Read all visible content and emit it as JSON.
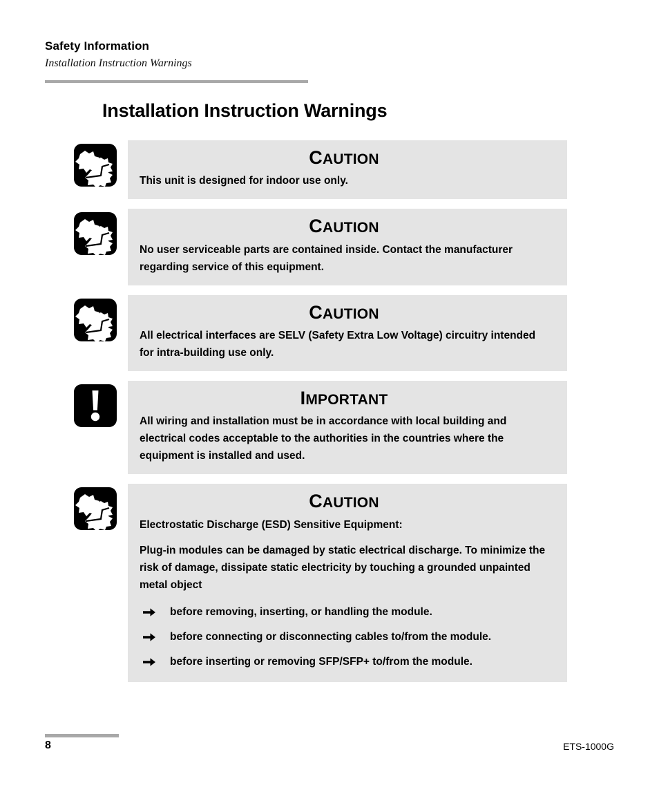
{
  "header": {
    "section_title": "Safety Information",
    "subsection_title": "Installation Instruction Warnings"
  },
  "page_title": "Installation Instruction Warnings",
  "notices": [
    {
      "icon": "esd-hand-shock-icon",
      "heading_first_letter": "C",
      "heading_rest": "AUTION",
      "heading_full": "CAUTION",
      "paragraphs": [
        "This unit is designed for indoor use only."
      ],
      "bullets": []
    },
    {
      "icon": "esd-hand-shock-icon",
      "heading_first_letter": "C",
      "heading_rest": "AUTION",
      "heading_full": "CAUTION",
      "paragraphs": [
        "No user serviceable parts are contained inside. Contact the manufacturer regarding service of this equipment."
      ],
      "bullets": []
    },
    {
      "icon": "esd-hand-shock-icon",
      "heading_first_letter": "C",
      "heading_rest": "AUTION",
      "heading_full": "CAUTION",
      "paragraphs": [
        "All electrical interfaces are SELV (Safety Extra Low Voltage) circuitry intended for intra-building use only."
      ],
      "bullets": []
    },
    {
      "icon": "exclamation-mark-icon",
      "heading_first_letter": "I",
      "heading_rest": "MPORTANT",
      "heading_full": "IMPORTANT",
      "paragraphs": [
        "All wiring and installation must be in accordance with local building and electrical codes acceptable to the authorities in the countries where the equipment is installed and used."
      ],
      "bullets": []
    },
    {
      "icon": "esd-hand-shock-icon",
      "heading_first_letter": "C",
      "heading_rest": "AUTION",
      "heading_full": "CAUTION",
      "paragraphs": [
        "Electrostatic Discharge (ESD) Sensitive Equipment:",
        "Plug-in modules can be damaged by static electrical discharge. To minimize the risk of damage, dissipate static electricity by touching a grounded unpainted metal object"
      ],
      "bullets": [
        "before removing, inserting, or handling the module.",
        "before connecting or disconnecting cables to/from the module.",
        "before inserting or removing SFP/SFP+ to/from the module."
      ]
    }
  ],
  "footer": {
    "page_number": "8",
    "document_code": "ETS-1000G"
  },
  "colors": {
    "notice_background": "#e4e4e4",
    "rule_gray": "#a8a8a8",
    "text": "#000000"
  }
}
